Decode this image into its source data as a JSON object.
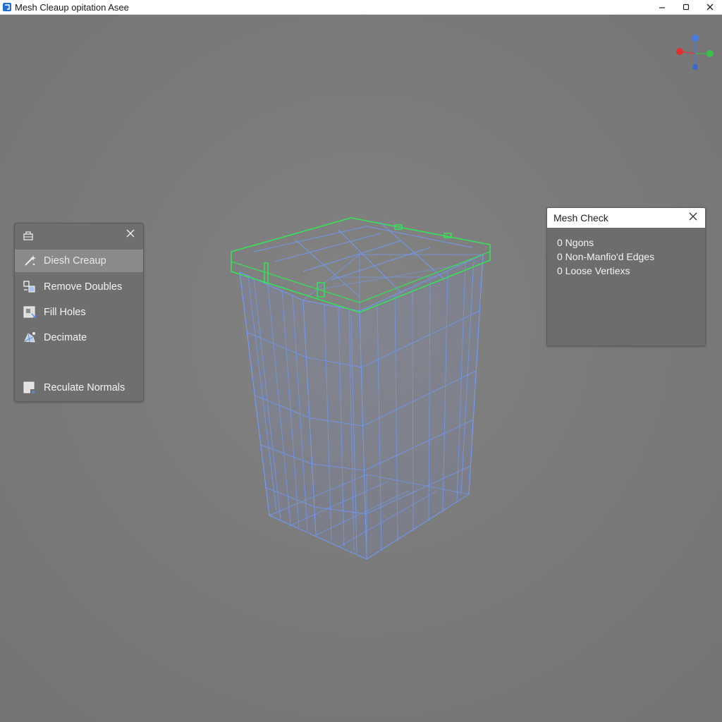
{
  "window": {
    "title": "Mesh Cleaup opitation Asee",
    "app_icon": "app-icon",
    "controls": {
      "minimize": "–",
      "maximize": "☐",
      "close": "✕"
    }
  },
  "colors": {
    "viewport_bg": "#7a7a7a",
    "wire_blue": "#6f9cff",
    "wire_green": "#38e05a",
    "panel_bg": "#6f6f6f",
    "active_item": "#8a8a8a"
  },
  "tool_panel": {
    "header_icon": "wrench-toolbox-icon",
    "close_label": "✕",
    "items": [
      {
        "label": "Diesh Creaup",
        "icon": "magic-wand-icon",
        "active": true
      },
      {
        "label": "Remove Doubles",
        "icon": "merge-vertices-icon",
        "active": false
      },
      {
        "label": "Fill Holes",
        "icon": "fill-holes-icon",
        "active": false
      },
      {
        "label": "Decimate",
        "icon": "decimate-icon",
        "active": false
      },
      {
        "label": "Reculate Normals",
        "icon": "normals-icon",
        "active": false
      }
    ]
  },
  "mesh_check": {
    "title": "Mesh Check",
    "close_label": "✕",
    "lines": [
      "0 Ngons",
      "0 Non-Manfio'd Edges",
      "0 Loose Vertiexs"
    ]
  },
  "gizmo": {
    "axes": [
      "x-axis-red",
      "y-axis-green",
      "z-axis-blue"
    ]
  }
}
